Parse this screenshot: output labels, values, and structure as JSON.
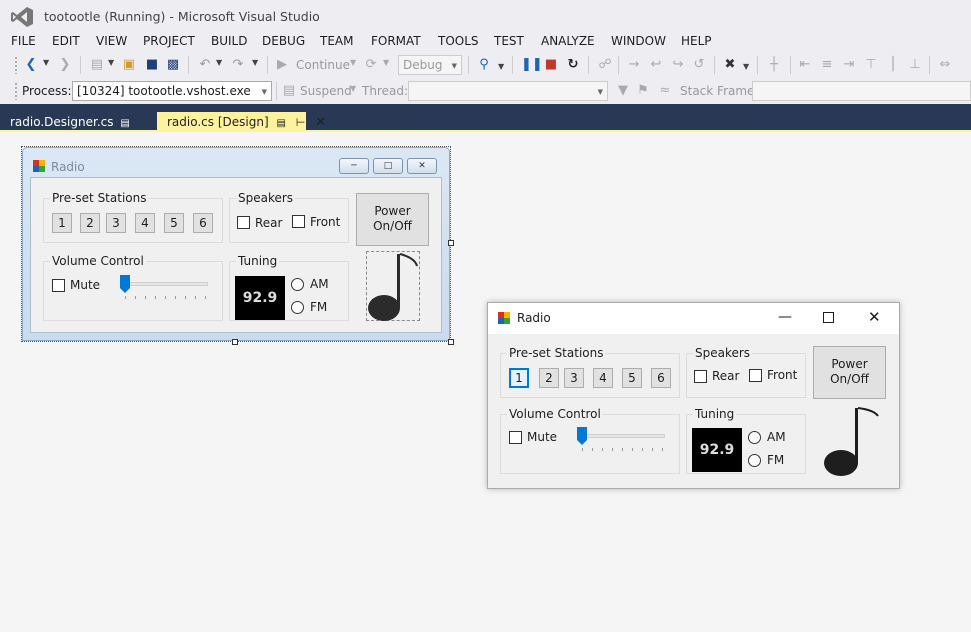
{
  "window": {
    "title": "tootootle (Running) - Microsoft Visual Studio"
  },
  "menu": [
    "FILE",
    "EDIT",
    "VIEW",
    "PROJECT",
    "BUILD",
    "DEBUG",
    "TEAM",
    "FORMAT",
    "TOOLS",
    "TEST",
    "ANALYZE",
    "WINDOW",
    "HELP"
  ],
  "toolbar": {
    "continue_label": "Continue",
    "config_value": "Debug",
    "icons": [
      "back-icon",
      "forward-icon",
      "new-project-icon",
      "open-file-icon",
      "save-icon",
      "save-all-icon",
      "undo-icon",
      "redo-icon",
      "continue-icon",
      "restart-debug-icon",
      "find-icon",
      "pause-icon",
      "stop-icon",
      "restart-icon",
      "show-next-statement-icon",
      "step-into-icon",
      "step-over-icon",
      "step-out-icon",
      "align-left-icon",
      "align-center-icon",
      "align-right-icon",
      "align-top-icon",
      "align-middle-icon",
      "align-bottom-icon",
      "space-icon"
    ]
  },
  "debug_toolbar": {
    "process_label": "Process:",
    "process_value": "[10324] tootootle.vshost.exe",
    "suspend_label": "Suspend",
    "thread_label": "Thread:",
    "stack_frame_label": "Stack Frame:"
  },
  "tabs": [
    {
      "label": "radio.Designer.cs",
      "active": false
    },
    {
      "label": "radio.cs [Design]",
      "active": true
    }
  ],
  "form": {
    "title": "Radio",
    "presets_label": "Pre-set Stations",
    "preset_buttons": [
      "1",
      "2",
      "3",
      "4",
      "5",
      "6"
    ],
    "speakers_label": "Speakers",
    "rear_label": "Rear",
    "front_label": "Front",
    "power_label": "Power\nOn/Off",
    "volume_label": "Volume Control",
    "mute_label": "Mute",
    "volume_level": 0,
    "tuning_label": "Tuning",
    "frequency": "92.9",
    "am_label": "AM",
    "fm_label": "FM"
  },
  "colors": {
    "accent": "#0078d7",
    "tab_active": "#fff29d",
    "tabstrip": "#293955",
    "stop": "#c0392b",
    "pause": "#1e64b4"
  }
}
